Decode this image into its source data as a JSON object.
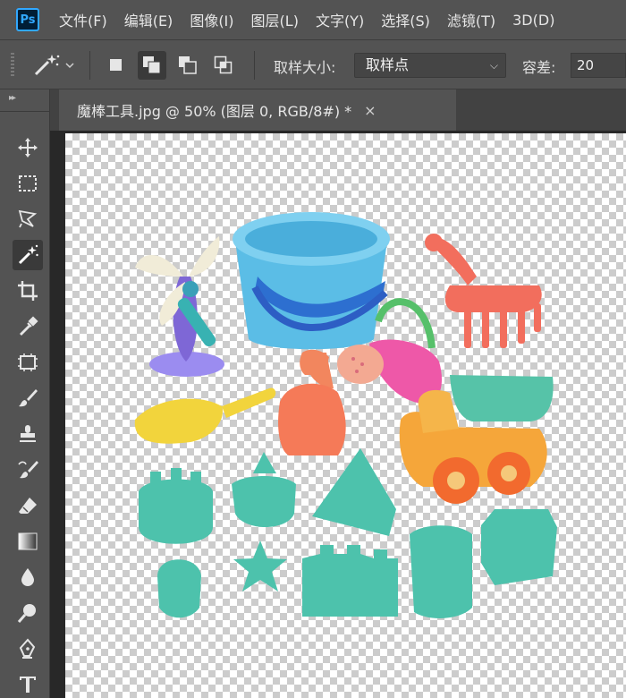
{
  "app": {
    "logo_text": "Ps"
  },
  "menu": [
    "文件(F)",
    "编辑(E)",
    "图像(I)",
    "图层(L)",
    "文字(Y)",
    "选择(S)",
    "滤镜(T)",
    "3D(D)"
  ],
  "options": {
    "sample_size_label": "取样大小:",
    "sample_size_value": "取样点",
    "tolerance_label": "容差:",
    "tolerance_value": "20"
  },
  "document": {
    "tab_title": "魔棒工具.jpg @ 50% (图层 0, RGB/8#) *",
    "close_glyph": "×"
  },
  "toolbox": {
    "collapse_glyph": "▸▸",
    "active_tool": "magic-wand"
  },
  "colors": {
    "accent": "#31a8ff",
    "panel": "#535353",
    "dark": "#282828"
  }
}
